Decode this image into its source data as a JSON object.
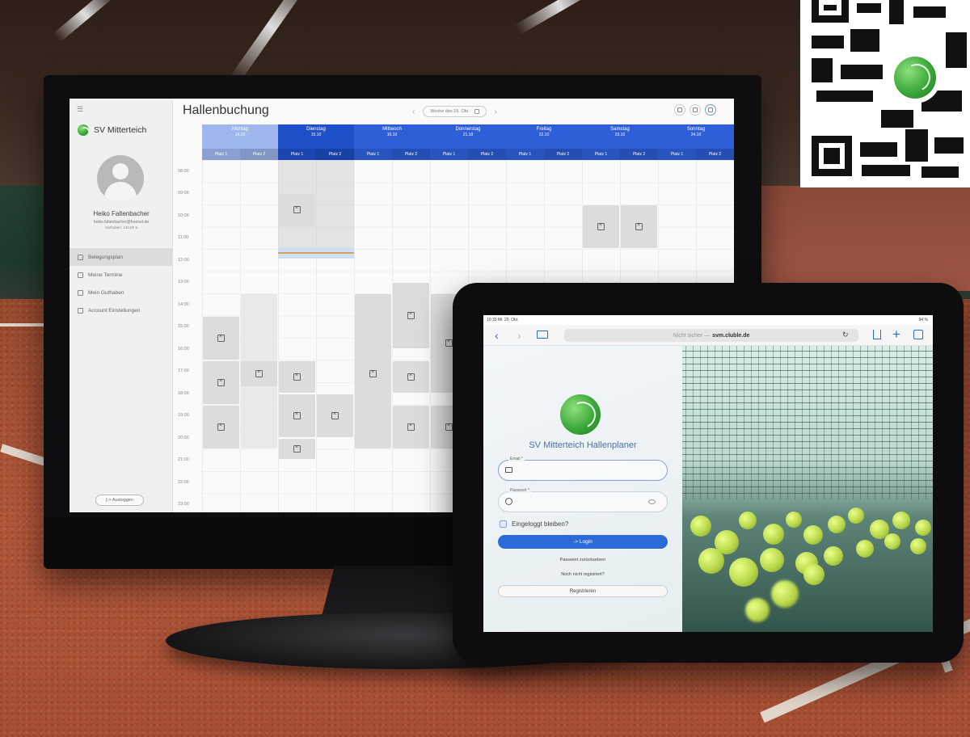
{
  "monitor_app": {
    "brand": "SV Mitterteich",
    "page_title": "Hallenbuchung",
    "user": {
      "name": "Heiko Faltenbacher",
      "email": "heiko.faltenbacher@freenet.de",
      "credit": "Guthaben: 140,00 €"
    },
    "nav": [
      {
        "label": "Belegungsplan",
        "icon": "calendar-grid-icon",
        "active": true
      },
      {
        "label": "Meine Termine",
        "icon": "calendar-icon",
        "active": false
      },
      {
        "label": "Mein Guthaben",
        "icon": "wallet-icon",
        "active": false
      },
      {
        "label": "Account Einstellungen",
        "icon": "settings-icon",
        "active": false
      }
    ],
    "logout_label": "[-> Ausloggen",
    "week_label": "Woche des 15. Okt.",
    "days": [
      {
        "name": "Montag",
        "date": "14.10",
        "state": "past"
      },
      {
        "name": "Dienstag",
        "date": "15.10",
        "state": "today"
      },
      {
        "name": "Mittwoch",
        "date": "16.10",
        "state": "future"
      },
      {
        "name": "Donnerstag",
        "date": "21.10",
        "state": "future"
      },
      {
        "name": "Freitag",
        "date": "22.10",
        "state": "future"
      },
      {
        "name": "Samstag",
        "date": "23.10",
        "state": "future"
      },
      {
        "name": "Sonntag",
        "date": "24.10",
        "state": "future"
      }
    ],
    "court_labels": [
      "Platz 1",
      "Platz 2"
    ],
    "times": [
      "08:00",
      "09:00",
      "10:00",
      "11:00",
      "12:00",
      "13:00",
      "14:00",
      "15:00",
      "16:00",
      "17:00",
      "18:00",
      "19:00",
      "20:00",
      "21:00",
      "22:00",
      "23:00"
    ],
    "colors": {
      "day_header_blue": "#2f5fd8",
      "day_header_past": "#9fb6ee",
      "booking_gray": "#dcdcdc"
    }
  },
  "tablet_app": {
    "status_left": "10:33 Mi. 20. Okt.",
    "status_right": "94 %",
    "url_prefix": "Nicht sicher —",
    "url_domain": "svm.cluble.de",
    "title": "SV Mitterteich Hallenplaner",
    "email_label": "Email *",
    "password_label": "Passwort *",
    "stay_logged_in": "Eingeloggt bleiben?",
    "login_button": "-> Login",
    "forgot_password": "Passwort zurücksetzen",
    "not_registered": "Noch nicht registriert?",
    "register_button": "Registrieren"
  }
}
